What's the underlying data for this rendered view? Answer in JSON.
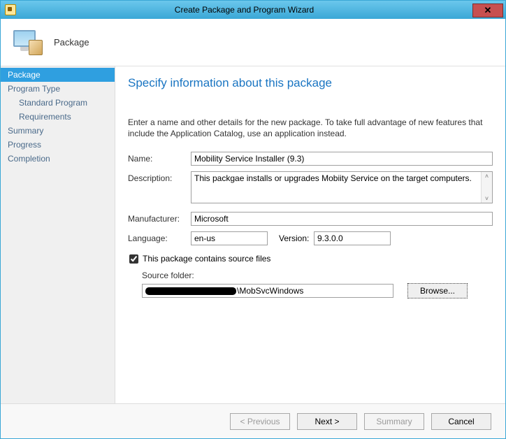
{
  "window": {
    "title": "Create Package and Program Wizard",
    "close_glyph": "✕"
  },
  "header": {
    "title": "Package"
  },
  "sidebar": {
    "items": [
      {
        "label": "Package",
        "selected": true,
        "sub": false
      },
      {
        "label": "Program Type",
        "selected": false,
        "sub": false
      },
      {
        "label": "Standard Program",
        "selected": false,
        "sub": true
      },
      {
        "label": "Requirements",
        "selected": false,
        "sub": true
      },
      {
        "label": "Summary",
        "selected": false,
        "sub": false
      },
      {
        "label": "Progress",
        "selected": false,
        "sub": false
      },
      {
        "label": "Completion",
        "selected": false,
        "sub": false
      }
    ]
  },
  "main": {
    "heading": "Specify information about this package",
    "instruction": "Enter a name and other details for the new package. To take full advantage of new features that include the Application Catalog, use an application instead.",
    "labels": {
      "name": "Name:",
      "description": "Description:",
      "manufacturer": "Manufacturer:",
      "language": "Language:",
      "version": "Version:",
      "source_chk": "This package contains source files",
      "source_folder": "Source folder:",
      "browse": "Browse..."
    },
    "values": {
      "name": "Mobility Service Installer (9.3)",
      "description": "This packgae installs or upgrades Mobiity Service on the target computers.",
      "manufacturer": "Microsoft",
      "language": "en-us",
      "version": "9.3.0.0",
      "source_checked": true,
      "source_path_visible": "\\MobSvcWindows"
    },
    "scroll": {
      "up": "˄",
      "down": "˅"
    }
  },
  "footer": {
    "previous": "< Previous",
    "next": "Next >",
    "summary": "Summary",
    "cancel": "Cancel"
  }
}
